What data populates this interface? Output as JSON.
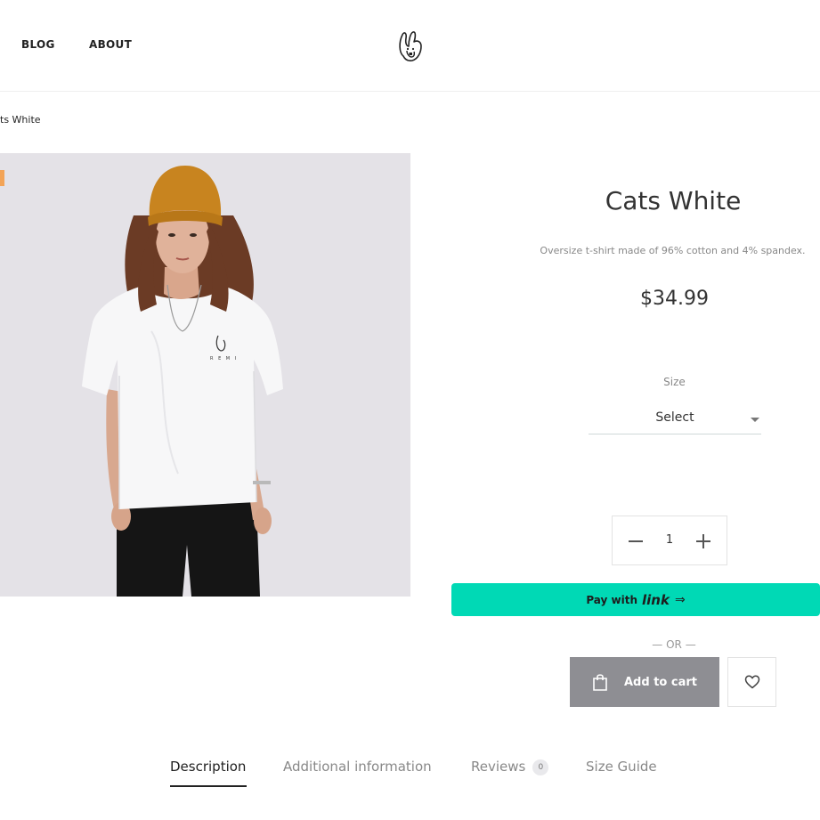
{
  "header": {
    "nav": [
      {
        "label": "BLOG"
      },
      {
        "label": "ABOUT"
      }
    ]
  },
  "breadcrumb": {
    "current": "ts White"
  },
  "product": {
    "title": "Cats White",
    "description": "Oversize t-shirt made of 96% cotton and 4% spandex.",
    "price": "$34.99",
    "size_label": "Size",
    "size_value": "Select",
    "quantity": "1",
    "pay_with": "Pay with",
    "pay_brand": "link",
    "or_text": "— OR —",
    "add_to_cart": "Add to cart"
  },
  "tabs": {
    "description": "Description",
    "additional": "Additional information",
    "reviews": "Reviews",
    "reviews_count": "0",
    "size_guide": "Size Guide"
  },
  "colors": {
    "accent_pay": "#00d9b5",
    "add_to_cart_bg": "#8e8e93",
    "sale_badge": "#f3a457",
    "image_bg": "#e4e2e7"
  },
  "icons": [
    "bunny-logo-icon",
    "bag-icon",
    "heart-icon",
    "minus-icon",
    "plus-icon",
    "chevron-down-icon",
    "arrow-right-icon"
  ]
}
